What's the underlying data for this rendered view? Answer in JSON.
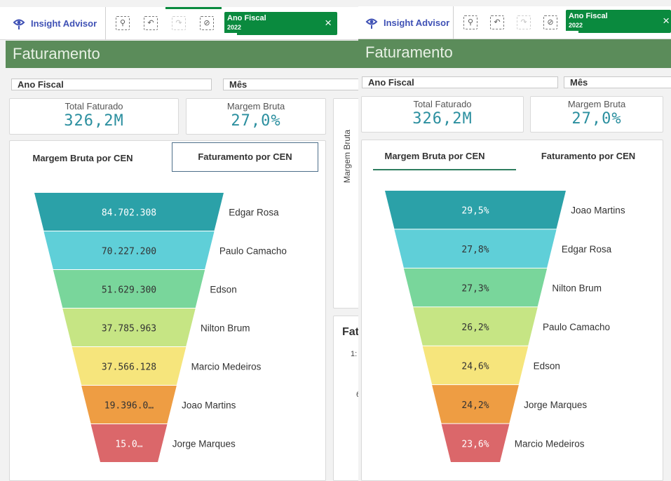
{
  "left": {
    "insight_label": "Insight Advisor",
    "chip": {
      "title": "Ano Fiscal",
      "value": "2022",
      "close": "×"
    },
    "sheet_title": "Faturamento",
    "filters": [
      "Ano Fiscal",
      "Mês"
    ],
    "kpis": [
      {
        "label": "Total Faturado",
        "value": "326,2M"
      },
      {
        "label": "Margem Bruta",
        "value": "27,0%"
      }
    ],
    "tabs": [
      "Margem Bruta por CEN",
      "Faturamento por CEN"
    ],
    "side_axis_label": "Margem Bruta",
    "side_card_title": "Fat",
    "side_card_tick1": "1:",
    "side_card_tick2": "6"
  },
  "right": {
    "insight_label": "Insight Advisor",
    "chip": {
      "title": "Ano Fiscal",
      "value": "2022",
      "close": "×"
    },
    "sheet_title": "Faturamento",
    "filters": [
      "Ano Fiscal",
      "Mês"
    ],
    "kpis": [
      {
        "label": "Total Faturado",
        "value": "326,2M"
      },
      {
        "label": "Margem Bruta",
        "value": "27,0%"
      }
    ],
    "tabs": [
      "Margem Bruta por CEN",
      "Faturamento por CEN"
    ]
  },
  "tool_icons": [
    "smart-search-icon",
    "step-back-icon",
    "step-forward-icon",
    "clear-selections-icon"
  ],
  "colors": {
    "header_green": "#5b8c5a",
    "selection_green": "#0a8a3e",
    "kpi_teal": "#2b8f9f",
    "funnel": [
      "#2ba1a8",
      "#5fcfd8",
      "#79d69b",
      "#c6e584",
      "#f6e57c",
      "#ee9d43",
      "#db676a"
    ]
  },
  "chart_data": [
    {
      "type": "funnel",
      "title": "Faturamento por CEN",
      "categories": [
        "Edgar Rosa",
        "Paulo Camacho",
        "Edson",
        "Nilton Brum",
        "Marcio Medeiros",
        "Joao Martins",
        "Jorge Marques"
      ],
      "values": [
        84702308,
        70227200,
        51629300,
        37785963,
        37566128,
        19396000,
        15000000
      ],
      "value_labels": [
        "84.702.308",
        "70.227.200",
        "51.629.300",
        "37.785.963",
        "37.566.128",
        "19.396.0…",
        "15.0…"
      ]
    },
    {
      "type": "funnel",
      "title": "Margem Bruta por CEN",
      "categories": [
        "Joao Martins",
        "Edgar Rosa",
        "Nilton Brum",
        "Paulo Camacho",
        "Edson",
        "Jorge Marques",
        "Marcio Medeiros"
      ],
      "values": [
        29.5,
        27.8,
        27.3,
        26.2,
        24.6,
        24.2,
        23.6
      ],
      "value_labels": [
        "29,5%",
        "27,8%",
        "27,3%",
        "26,2%",
        "24,6%",
        "24,2%",
        "23,6%"
      ]
    }
  ]
}
